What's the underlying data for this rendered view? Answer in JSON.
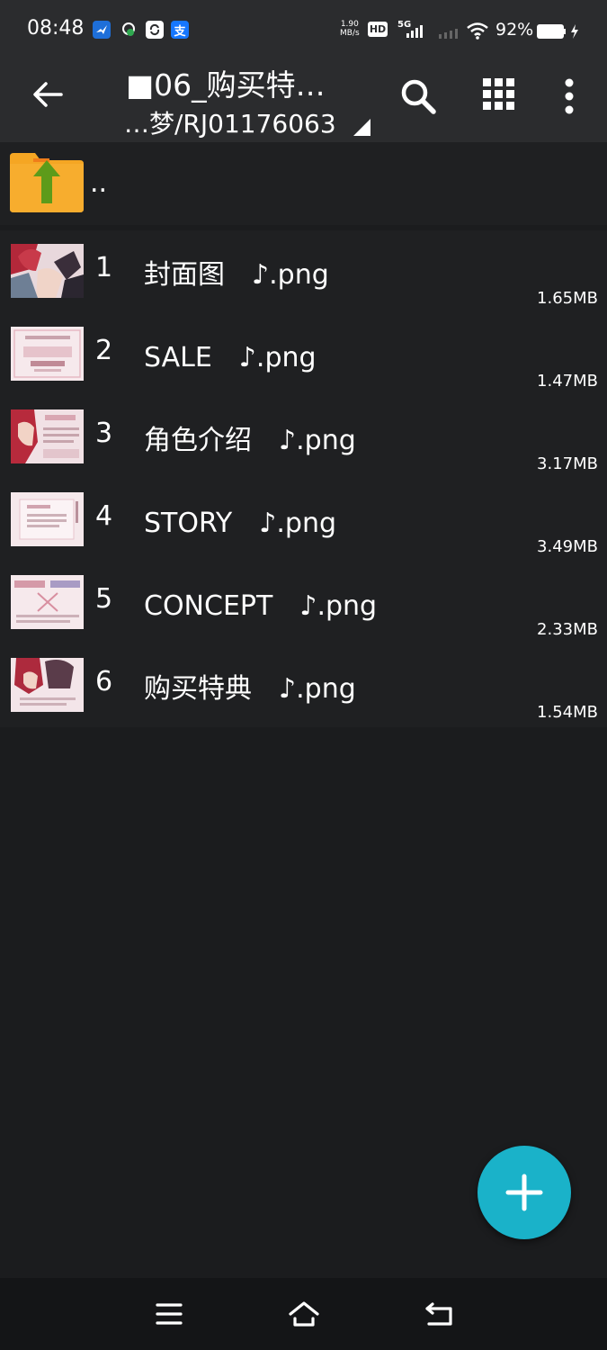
{
  "status_bar": {
    "time": "08:48",
    "net_speed_value": "1.90",
    "net_speed_unit": "MB/s",
    "hd_label": "HD",
    "network_type": "5G",
    "battery_percent": "92%",
    "app_icons": [
      {
        "icon": "bird-app-icon",
        "color": "#1e6fd9"
      },
      {
        "icon": "location-lock-icon",
        "color": "#2fa84f"
      },
      {
        "icon": "sync-app-icon",
        "color": "#ffffff"
      },
      {
        "icon": "alipay-icon",
        "glyph": "支",
        "color": "#1677ff"
      }
    ]
  },
  "toolbar": {
    "title": "■06_购买特…",
    "subtitle": "…梦/RJ01176063",
    "back_icon": "arrow-left-icon",
    "search_icon": "search-icon",
    "grid_icon": "grid-view-icon",
    "menu_icon": "more-vert-icon"
  },
  "parent_dir": {
    "label": "..",
    "icon": "folder-up-icon"
  },
  "files": [
    {
      "num": "1",
      "name": "封面图　♪.png",
      "size": "1.65MB",
      "thumb_icon": "cover-thumbnail"
    },
    {
      "num": "2",
      "name": "SALE　♪.png",
      "size": "1.47MB",
      "thumb_icon": "sale-thumbnail"
    },
    {
      "num": "3",
      "name": "角色介绍　♪.png",
      "size": "3.17MB",
      "thumb_icon": "character-thumbnail"
    },
    {
      "num": "4",
      "name": "STORY　♪.png",
      "size": "3.49MB",
      "thumb_icon": "story-thumbnail"
    },
    {
      "num": "5",
      "name": "CONCEPT　♪.png",
      "size": "2.33MB",
      "thumb_icon": "concept-thumbnail"
    },
    {
      "num": "6",
      "name": "购买特典　♪.png",
      "size": "1.54MB",
      "thumb_icon": "bonus-thumbnail"
    }
  ],
  "fab": {
    "icon": "plus-icon",
    "color": "#1ab2c9"
  },
  "nav_bar": {
    "menu_icon": "menu-lines-icon",
    "home_icon": "home-icon",
    "back_icon": "back-return-icon"
  },
  "colors": {
    "toolbar_bg": "#2b2c2e",
    "list_bg": "#1f2022",
    "screen_bg": "#1b1c1e",
    "folder_orange": "#f5a623",
    "folder_arrow_green": "#5d9b1a"
  }
}
